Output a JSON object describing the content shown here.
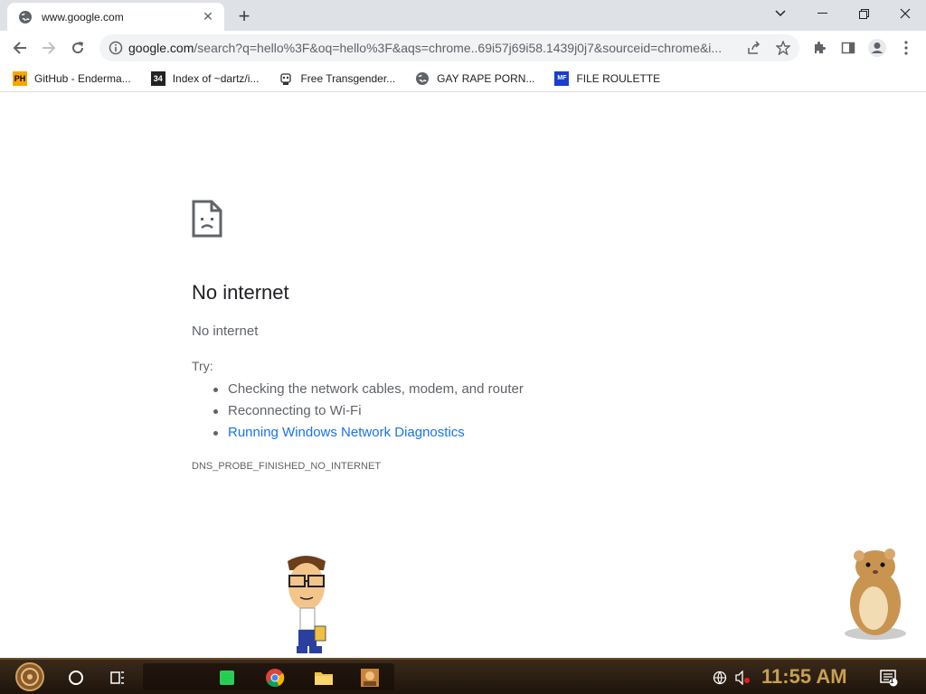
{
  "browser": {
    "tab_title": "www.google.com",
    "url_host": "google.com",
    "url_path": "/search?q=hello%3F&oq=hello%3F&aqs=chrome..69i57j69i58.1439j0j7&sourceid=chrome&i..."
  },
  "bookmarks": [
    {
      "label": "GitHub - Enderma...",
      "icon_text": "PH"
    },
    {
      "label": "Index of ~dartz/i...",
      "icon_text": "34"
    },
    {
      "label": "Free Transgender...",
      "icon_text": ""
    },
    {
      "label": "GAY RAPE PORN...",
      "icon_text": ""
    },
    {
      "label": "FILE ROULETTE",
      "icon_text": "MF"
    }
  ],
  "error": {
    "title": "No internet",
    "subtitle": "No internet",
    "try_label": "Try:",
    "suggestions": [
      "Checking the network cables, modem, and router",
      "Reconnecting to Wi-Fi",
      "Running Windows Network Diagnostics"
    ],
    "code": "DNS_PROBE_FINISHED_NO_INTERNET"
  },
  "taskbar": {
    "clock": "11:55 AM",
    "notification_count": "1"
  },
  "colors": {
    "link": "#1a73e8",
    "tabstrip": "#dee1e6",
    "clock": "#c8a050"
  }
}
